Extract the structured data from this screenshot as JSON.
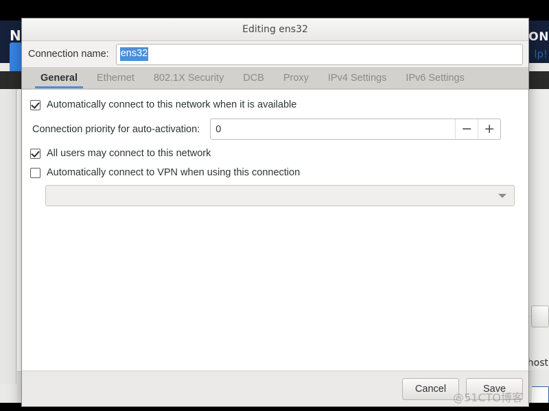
{
  "background": {
    "header_title": "N",
    "header_title_right": "TION",
    "help_link": "lp!",
    "host_label": "host"
  },
  "dialog": {
    "title": "Editing ens32",
    "connection_name": {
      "label": "Connection name:",
      "value": "ens32",
      "placeholder": ""
    },
    "tabs": [
      {
        "label": "General",
        "active": true
      },
      {
        "label": "Ethernet",
        "active": false
      },
      {
        "label": "802.1X Security",
        "active": false
      },
      {
        "label": "DCB",
        "active": false
      },
      {
        "label": "Proxy",
        "active": false
      },
      {
        "label": "IPv4 Settings",
        "active": false
      },
      {
        "label": "IPv6 Settings",
        "active": false
      }
    ],
    "general": {
      "auto_connect": {
        "label": "Automatically connect to this network when it is available",
        "checked": true
      },
      "priority": {
        "label": "Connection priority for auto-activation:",
        "value": "0",
        "decrement": "−",
        "increment": "+"
      },
      "all_users": {
        "label": "All users may connect to this network",
        "checked": true
      },
      "auto_vpn": {
        "label": "Automatically connect to VPN when using this connection",
        "checked": false
      },
      "vpn_select": {
        "value": "",
        "options": []
      }
    },
    "footer": {
      "cancel_label": "Cancel",
      "save_label": "Save"
    }
  },
  "watermark": "@51CTO博客",
  "colors": {
    "accent": "#4a90d9",
    "titlebar": "#f2f1f0",
    "dark_header": "#15203a",
    "tabbar": "#d2d1ce"
  }
}
